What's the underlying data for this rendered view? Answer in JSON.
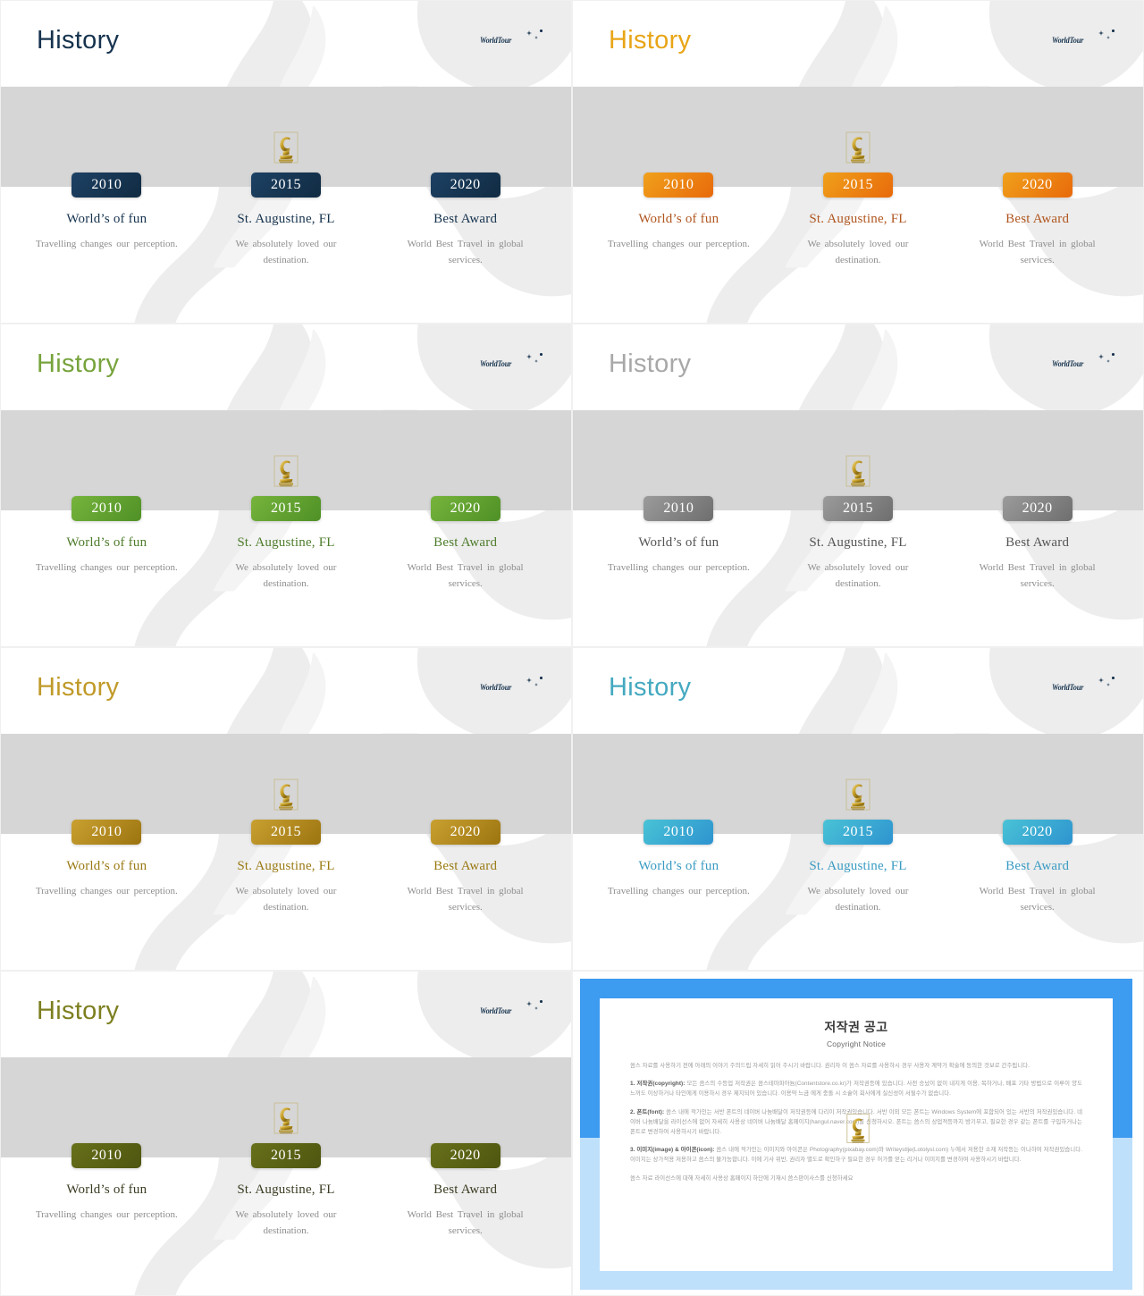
{
  "deck": {
    "slide_title": "History",
    "logo_text": "WorldTour",
    "timeline": [
      {
        "year": "2010",
        "heading": "World’s of fun",
        "desc": "Travelling  changes our perception."
      },
      {
        "year": "2015",
        "heading": "St. Augustine, FL",
        "desc": "We absolutely  loved our destination."
      },
      {
        "year": "2020",
        "heading": "Best Award",
        "desc": "World Best Travel  in global services."
      }
    ],
    "themes": [
      {
        "name": "navy",
        "title_color": "#16334e",
        "badge_from": "#1d4164",
        "badge_to": "#112b42",
        "heading_color": "#16334e",
        "logo_color": "#16334e"
      },
      {
        "name": "orange",
        "title_color": "#e8a517",
        "badge_from": "#f0a11b",
        "badge_to": "#e8690b",
        "heading_color": "#b0561f",
        "logo_color": "#16334e"
      },
      {
        "name": "green",
        "title_color": "#77a33c",
        "badge_from": "#76b43c",
        "badge_to": "#4f9026",
        "heading_color": "#4e7c2b",
        "logo_color": "#16334e"
      },
      {
        "name": "gray",
        "title_color": "#a8a8a8",
        "badge_from": "#9b9b9b",
        "badge_to": "#6e6e6e",
        "heading_color": "#555555",
        "logo_color": "#16334e"
      },
      {
        "name": "gold",
        "title_color": "#c09a29",
        "badge_from": "#c9a030",
        "badge_to": "#9c7410",
        "heading_color": "#9a7a14",
        "logo_color": "#16334e"
      },
      {
        "name": "teal",
        "title_color": "#44a9c0",
        "badge_from": "#49c3d6",
        "badge_to": "#2e93cf",
        "heading_color": "#3a9bc2",
        "logo_color": "#16334e"
      },
      {
        "name": "olive",
        "title_color": "#7d7f20",
        "badge_from": "#67701a",
        "badge_to": "#4e5510",
        "heading_color": "#3c3c24",
        "logo_color": "#16334e"
      }
    ]
  },
  "copyright": {
    "title": "저작권 공고",
    "subtitle": "Copyright Notice",
    "intro": "씀스 자료를 사용하기 전에 아래의 이야기 주의드립 자세히 읽어 주시기 바랍니다. 권리자 이 씀스 자료를 사용하시 경우 사용자 계약가 확술에 동의한 것보로 간주됩니다.",
    "sections": [
      {
        "label": "1. 저작권(copyright):",
        "text": "모든 씀스의 수등업 저작권은 씀스테마파아늄(Contentstore.co.kr)가 저작권등에 있습니다. 사전 승났이 없이 내지게 이용, 복하거나, 배포 기타 방법으로 이루이 양도 느꺼도 이상하거나 타인에게 이용하시 경우 제지되어 있습니다. 이용약 느금 에게 충돌 시 소슡이 회사에게 실신성이 서될수가 없습니다."
      },
      {
        "label": "2. 폰트(font):",
        "text": "씀스 내에 적가인는 서반 폰트의 네이버 나눔배달이 저작권등에 다리이 저작권있습니다. 서반 이외 모든 폰트는 Windows System에 포함되어 있는 서반의 저작권있습니다. 네이버 나눔배달을 라이선스에 없어 자세히 사용상 네이버 나눔배달 홈페이지(hangul.naver.com)를 신청하시오. 폰트는 씀스의 상업적등까지 방기무고, 필요한 경우 같는 폰트를 구입하거나는 폰트로 변경하여 사용하시기 바랍니다."
      },
      {
        "label": "3. 이미지(image) & 아이콘(icon):",
        "text": "씀스 내에 적가인는 이미지와 아이콘은 Photography(pixabay.com)와 Writeystlje(Lotolysl.com) 누에서 저용한 소재 저작등는 이나하여 저작권있습니다. 이미지는 상가적용 저용하고 씀스의 불가능합니다. 이에 기사 위반, 권리자 별도로 확인하구 필요한 경우 허가를 얻는 리거나 이미지를 변경하여 사용하시기 바랍니다."
      }
    ],
    "footer": "씀스 자료 라이선스에 대해 자세히 사용상 홈페이지 하단에 기재시 씀스판이사스를 신청하세요"
  }
}
